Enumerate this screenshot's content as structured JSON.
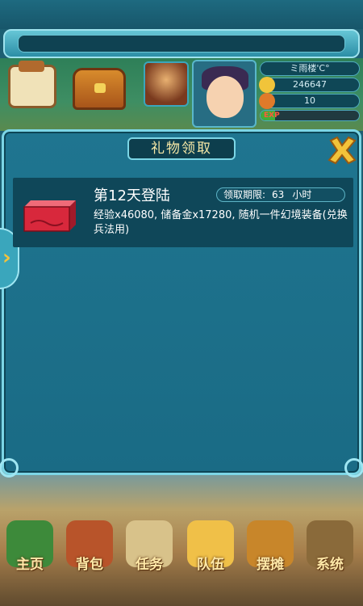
{
  "colors": {
    "dialog_bg": "#1a6b85",
    "dialog_border": "#7cd6e6",
    "title_text": "#f5e7a6",
    "close_icon": "#f3c33a",
    "exp_fill": "#3fae3c"
  },
  "player": {
    "name": "ミ雨楼'C°",
    "currency": "246647",
    "level": "10",
    "exp_label": "EXP",
    "exp_fraction": 0.15
  },
  "dialog": {
    "title": "礼物领取",
    "close_icon": "close-x-icon",
    "side_arrow_icon": "chevron-right-icon"
  },
  "reward": {
    "icon": "red-gift-box-icon",
    "title": "第12天登陆",
    "deadline_label": "领取期限:",
    "deadline_value": "63",
    "deadline_unit": "小时",
    "description": "经验x46080, 储备金x17280, 随机一件幻境装备(兑换兵法用)"
  },
  "bottom_menu": [
    {
      "label": "主页",
      "icon": "home-icon"
    },
    {
      "label": "背包",
      "icon": "backpack-chest-icon"
    },
    {
      "label": "任务",
      "icon": "scroll-icon"
    },
    {
      "label": "队伍",
      "icon": "team-icon"
    },
    {
      "label": "摆摊",
      "icon": "stall-icon"
    },
    {
      "label": "系统",
      "icon": "gear-icon"
    }
  ]
}
